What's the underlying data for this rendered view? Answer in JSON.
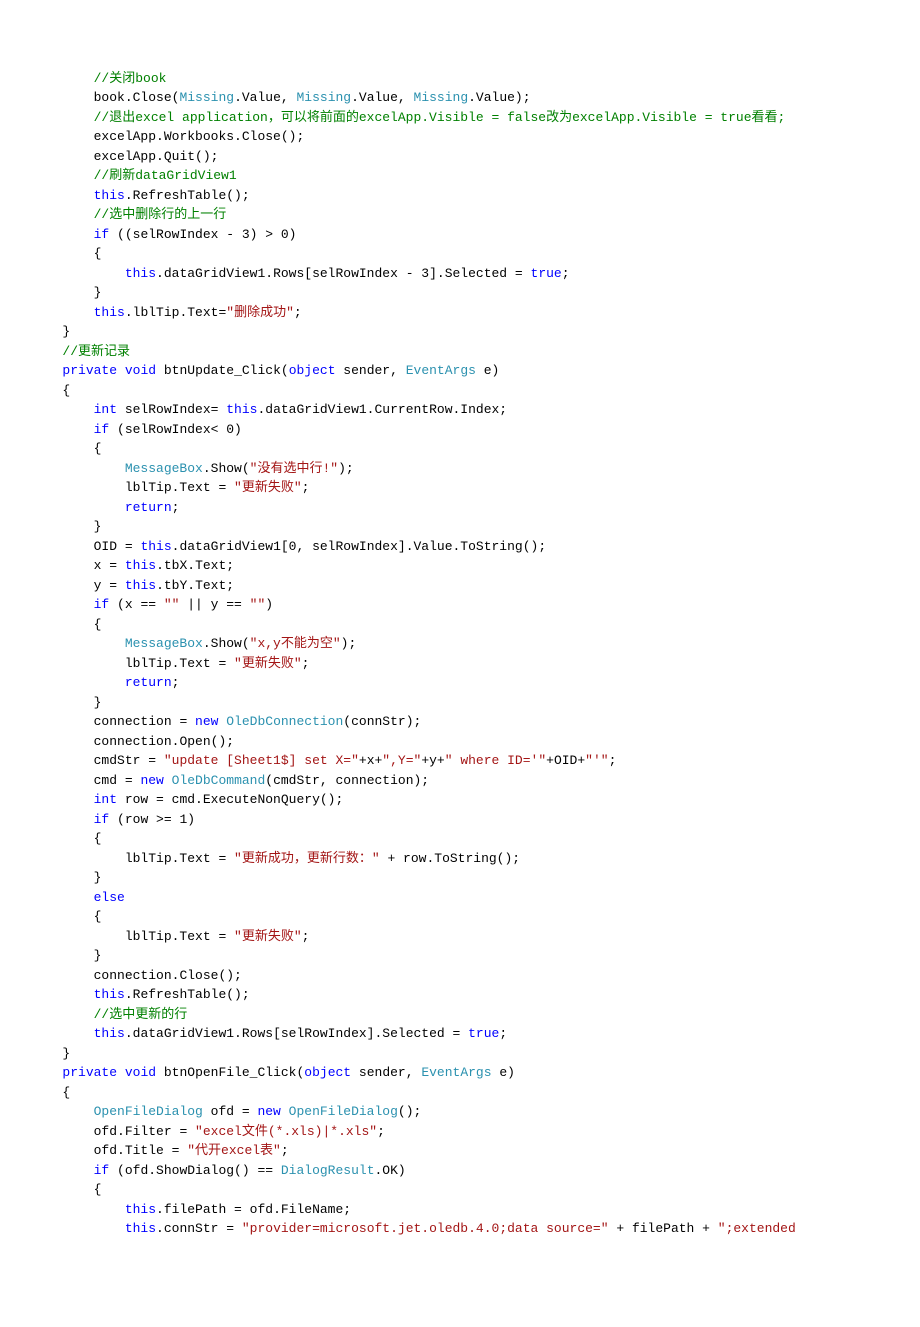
{
  "lines": [
    {
      "indent": 12,
      "tokens": [
        {
          "t": "//关闭book",
          "cls": "c-comment"
        }
      ]
    },
    {
      "indent": 12,
      "tokens": [
        {
          "t": "book.Close("
        },
        {
          "t": "Missing",
          "cls": "c-type"
        },
        {
          "t": ".Value, "
        },
        {
          "t": "Missing",
          "cls": "c-type"
        },
        {
          "t": ".Value, "
        },
        {
          "t": "Missing",
          "cls": "c-type"
        },
        {
          "t": ".Value);"
        }
      ]
    },
    {
      "indent": 12,
      "tokens": [
        {
          "t": "//退出excel application，可以将前面的excelApp.Visible = false改为excelApp.Visible = true看看;",
          "cls": "c-comment"
        }
      ]
    },
    {
      "indent": 12,
      "tokens": [
        {
          "t": "excelApp.Workbooks.Close();"
        }
      ]
    },
    {
      "indent": 12,
      "tokens": [
        {
          "t": "excelApp.Quit();"
        }
      ]
    },
    {
      "indent": 12,
      "tokens": [
        {
          "t": "//刷新dataGridView1",
          "cls": "c-comment"
        }
      ]
    },
    {
      "indent": 12,
      "tokens": [
        {
          "t": "this",
          "cls": "c-keyword"
        },
        {
          "t": ".RefreshTable();"
        }
      ]
    },
    {
      "indent": 12,
      "tokens": [
        {
          "t": "//选中删除行的上一行",
          "cls": "c-comment"
        }
      ]
    },
    {
      "indent": 12,
      "tokens": [
        {
          "t": "if",
          "cls": "c-keyword"
        },
        {
          "t": " ((selRowIndex - 3) > 0)"
        }
      ]
    },
    {
      "indent": 12,
      "tokens": [
        {
          "t": "{"
        }
      ]
    },
    {
      "indent": 16,
      "tokens": [
        {
          "t": "this",
          "cls": "c-keyword"
        },
        {
          "t": ".dataGridView1.Rows[selRowIndex - 3].Selected = "
        },
        {
          "t": "true",
          "cls": "c-keyword"
        },
        {
          "t": ";"
        }
      ]
    },
    {
      "indent": 12,
      "tokens": [
        {
          "t": "}"
        }
      ]
    },
    {
      "indent": 12,
      "tokens": [
        {
          "t": "this",
          "cls": "c-keyword"
        },
        {
          "t": ".lblTip.Text="
        },
        {
          "t": "\"删除成功\"",
          "cls": "c-string"
        },
        {
          "t": ";"
        }
      ]
    },
    {
      "indent": 8,
      "tokens": [
        {
          "t": "}"
        }
      ]
    },
    {
      "indent": 0,
      "tokens": [
        {
          "t": ""
        }
      ]
    },
    {
      "indent": 8,
      "tokens": [
        {
          "t": "//更新记录",
          "cls": "c-comment"
        }
      ]
    },
    {
      "indent": 8,
      "tokens": [
        {
          "t": "private",
          "cls": "c-keyword"
        },
        {
          "t": " "
        },
        {
          "t": "void",
          "cls": "c-keyword"
        },
        {
          "t": " btnUpdate_Click("
        },
        {
          "t": "object",
          "cls": "c-keyword"
        },
        {
          "t": " sender, "
        },
        {
          "t": "EventArgs",
          "cls": "c-type"
        },
        {
          "t": " e)"
        }
      ]
    },
    {
      "indent": 8,
      "tokens": [
        {
          "t": "{"
        }
      ]
    },
    {
      "indent": 12,
      "tokens": [
        {
          "t": "int",
          "cls": "c-keyword"
        },
        {
          "t": " selRowIndex= "
        },
        {
          "t": "this",
          "cls": "c-keyword"
        },
        {
          "t": ".dataGridView1.CurrentRow.Index;"
        }
      ]
    },
    {
      "indent": 12,
      "tokens": [
        {
          "t": "if",
          "cls": "c-keyword"
        },
        {
          "t": " (selRowIndex< 0)"
        }
      ]
    },
    {
      "indent": 12,
      "tokens": [
        {
          "t": "{"
        }
      ]
    },
    {
      "indent": 16,
      "tokens": [
        {
          "t": "MessageBox",
          "cls": "c-type"
        },
        {
          "t": ".Show("
        },
        {
          "t": "\"没有选中行!\"",
          "cls": "c-string"
        },
        {
          "t": ");"
        }
      ]
    },
    {
      "indent": 16,
      "tokens": [
        {
          "t": "lblTip.Text = "
        },
        {
          "t": "\"更新失败\"",
          "cls": "c-string"
        },
        {
          "t": ";"
        }
      ]
    },
    {
      "indent": 16,
      "tokens": [
        {
          "t": "return",
          "cls": "c-keyword"
        },
        {
          "t": ";"
        }
      ]
    },
    {
      "indent": 12,
      "tokens": [
        {
          "t": "}"
        }
      ]
    },
    {
      "indent": 12,
      "tokens": [
        {
          "t": "OID = "
        },
        {
          "t": "this",
          "cls": "c-keyword"
        },
        {
          "t": ".dataGridView1[0, selRowIndex].Value.ToString();"
        }
      ]
    },
    {
      "indent": 12,
      "tokens": [
        {
          "t": "x = "
        },
        {
          "t": "this",
          "cls": "c-keyword"
        },
        {
          "t": ".tbX.Text;"
        }
      ]
    },
    {
      "indent": 12,
      "tokens": [
        {
          "t": "y = "
        },
        {
          "t": "this",
          "cls": "c-keyword"
        },
        {
          "t": ".tbY.Text;"
        }
      ]
    },
    {
      "indent": 12,
      "tokens": [
        {
          "t": "if",
          "cls": "c-keyword"
        },
        {
          "t": " (x == "
        },
        {
          "t": "\"\"",
          "cls": "c-string"
        },
        {
          "t": " || y == "
        },
        {
          "t": "\"\"",
          "cls": "c-string"
        },
        {
          "t": ")"
        }
      ]
    },
    {
      "indent": 12,
      "tokens": [
        {
          "t": "{"
        }
      ]
    },
    {
      "indent": 16,
      "tokens": [
        {
          "t": "MessageBox",
          "cls": "c-type"
        },
        {
          "t": ".Show("
        },
        {
          "t": "\"x,y不能为空\"",
          "cls": "c-string"
        },
        {
          "t": ");"
        }
      ]
    },
    {
      "indent": 16,
      "tokens": [
        {
          "t": "lblTip.Text = "
        },
        {
          "t": "\"更新失败\"",
          "cls": "c-string"
        },
        {
          "t": ";"
        }
      ]
    },
    {
      "indent": 16,
      "tokens": [
        {
          "t": "return",
          "cls": "c-keyword"
        },
        {
          "t": ";"
        }
      ]
    },
    {
      "indent": 12,
      "tokens": [
        {
          "t": "}"
        }
      ]
    },
    {
      "indent": 12,
      "tokens": [
        {
          "t": "connection = "
        },
        {
          "t": "new",
          "cls": "c-keyword"
        },
        {
          "t": " "
        },
        {
          "t": "OleDbConnection",
          "cls": "c-type"
        },
        {
          "t": "(connStr);"
        }
      ]
    },
    {
      "indent": 12,
      "tokens": [
        {
          "t": "connection.Open();"
        }
      ]
    },
    {
      "indent": 12,
      "tokens": [
        {
          "t": "cmdStr = "
        },
        {
          "t": "\"update [Sheet1$] set X=\"",
          "cls": "c-string"
        },
        {
          "t": "+x+"
        },
        {
          "t": "\",Y=\"",
          "cls": "c-string"
        },
        {
          "t": "+y+"
        },
        {
          "t": "\" where ID='\"",
          "cls": "c-string"
        },
        {
          "t": "+OID+"
        },
        {
          "t": "\"'\"",
          "cls": "c-string"
        },
        {
          "t": ";"
        }
      ]
    },
    {
      "indent": 12,
      "tokens": [
        {
          "t": "cmd = "
        },
        {
          "t": "new",
          "cls": "c-keyword"
        },
        {
          "t": " "
        },
        {
          "t": "OleDbCommand",
          "cls": "c-type"
        },
        {
          "t": "(cmdStr, connection);"
        }
      ]
    },
    {
      "indent": 12,
      "tokens": [
        {
          "t": "int",
          "cls": "c-keyword"
        },
        {
          "t": " row = cmd.ExecuteNonQuery();"
        }
      ]
    },
    {
      "indent": 12,
      "tokens": [
        {
          "t": "if",
          "cls": "c-keyword"
        },
        {
          "t": " (row >= 1)"
        }
      ]
    },
    {
      "indent": 12,
      "tokens": [
        {
          "t": "{"
        }
      ]
    },
    {
      "indent": 16,
      "tokens": [
        {
          "t": "lblTip.Text = "
        },
        {
          "t": "\"更新成功，更新行数：\"",
          "cls": "c-string"
        },
        {
          "t": " + row.ToString();"
        }
      ]
    },
    {
      "indent": 12,
      "tokens": [
        {
          "t": "}"
        }
      ]
    },
    {
      "indent": 12,
      "tokens": [
        {
          "t": "else",
          "cls": "c-keyword"
        }
      ]
    },
    {
      "indent": 12,
      "tokens": [
        {
          "t": "{"
        }
      ]
    },
    {
      "indent": 16,
      "tokens": [
        {
          "t": "lblTip.Text = "
        },
        {
          "t": "\"更新失败\"",
          "cls": "c-string"
        },
        {
          "t": ";"
        }
      ]
    },
    {
      "indent": 12,
      "tokens": [
        {
          "t": "}"
        }
      ]
    },
    {
      "indent": 12,
      "tokens": [
        {
          "t": "connection.Close();"
        }
      ]
    },
    {
      "indent": 12,
      "tokens": [
        {
          "t": "this",
          "cls": "c-keyword"
        },
        {
          "t": ".RefreshTable();"
        }
      ]
    },
    {
      "indent": 12,
      "tokens": [
        {
          "t": "//选中更新的行",
          "cls": "c-comment"
        }
      ]
    },
    {
      "indent": 12,
      "tokens": [
        {
          "t": "this",
          "cls": "c-keyword"
        },
        {
          "t": ".dataGridView1.Rows[selRowIndex].Selected = "
        },
        {
          "t": "true",
          "cls": "c-keyword"
        },
        {
          "t": ";"
        }
      ]
    },
    {
      "indent": 8,
      "tokens": [
        {
          "t": "}"
        }
      ]
    },
    {
      "indent": 0,
      "tokens": [
        {
          "t": ""
        }
      ]
    },
    {
      "indent": 8,
      "tokens": [
        {
          "t": "private",
          "cls": "c-keyword"
        },
        {
          "t": " "
        },
        {
          "t": "void",
          "cls": "c-keyword"
        },
        {
          "t": " btnOpenFile_Click("
        },
        {
          "t": "object",
          "cls": "c-keyword"
        },
        {
          "t": " sender, "
        },
        {
          "t": "EventArgs",
          "cls": "c-type"
        },
        {
          "t": " e)"
        }
      ]
    },
    {
      "indent": 8,
      "tokens": [
        {
          "t": "{"
        }
      ]
    },
    {
      "indent": 12,
      "tokens": [
        {
          "t": "OpenFileDialog",
          "cls": "c-type"
        },
        {
          "t": " ofd = "
        },
        {
          "t": "new",
          "cls": "c-keyword"
        },
        {
          "t": " "
        },
        {
          "t": "OpenFileDialog",
          "cls": "c-type"
        },
        {
          "t": "();"
        }
      ]
    },
    {
      "indent": 12,
      "tokens": [
        {
          "t": "ofd.Filter = "
        },
        {
          "t": "\"excel文件(*.xls)|*.xls\"",
          "cls": "c-string"
        },
        {
          "t": ";"
        }
      ]
    },
    {
      "indent": 12,
      "tokens": [
        {
          "t": "ofd.Title = "
        },
        {
          "t": "\"代开excel表\"",
          "cls": "c-string"
        },
        {
          "t": ";"
        }
      ]
    },
    {
      "indent": 12,
      "tokens": [
        {
          "t": "if",
          "cls": "c-keyword"
        },
        {
          "t": " (ofd.ShowDialog() == "
        },
        {
          "t": "DialogResult",
          "cls": "c-type"
        },
        {
          "t": ".OK)"
        }
      ]
    },
    {
      "indent": 12,
      "tokens": [
        {
          "t": "{"
        }
      ]
    },
    {
      "indent": 16,
      "tokens": [
        {
          "t": "this",
          "cls": "c-keyword"
        },
        {
          "t": ".filePath = ofd.FileName;"
        }
      ]
    },
    {
      "indent": 16,
      "tokens": [
        {
          "t": "this",
          "cls": "c-keyword"
        },
        {
          "t": ".connStr = "
        },
        {
          "t": "\"provider=microsoft.jet.oledb.4.0;data source=\"",
          "cls": "c-string"
        },
        {
          "t": " + filePath + "
        },
        {
          "t": "\";extended",
          "cls": "c-string"
        }
      ]
    }
  ]
}
